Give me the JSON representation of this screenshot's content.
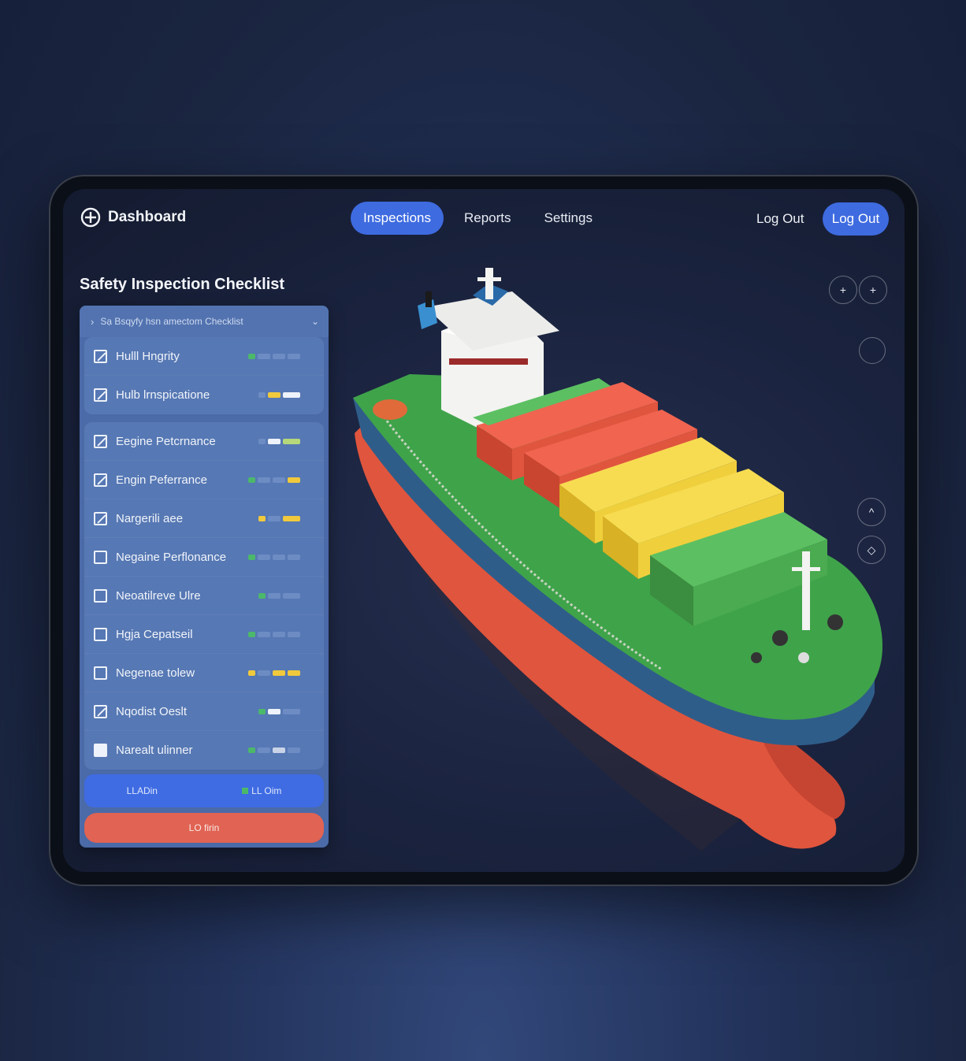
{
  "nav": {
    "brand": "Dashboard",
    "items": [
      {
        "label": "Inspections",
        "active": true
      },
      {
        "label": "Reports",
        "active": false
      },
      {
        "label": "Settings",
        "active": false
      }
    ],
    "logout_text": "Log Out",
    "logout_button": "Log Out"
  },
  "checklist": {
    "title": "Safety Inspection Checklist",
    "header": "Sạ Bsqyfy hsn amectom Checklist",
    "group1": [
      {
        "label": "Hulll Hngrity",
        "state": "checked",
        "bars": [
          "#4cb86a",
          "#6d8cc4",
          "#6d8cc4",
          "#6d8cc4"
        ]
      },
      {
        "label": "Hulb lrnspicatione",
        "state": "checked",
        "bars": [
          "#6d8cc4",
          "#f1c93c",
          "#eef2fa"
        ]
      }
    ],
    "group2": [
      {
        "label": "Eegine Petcrnance",
        "state": "checked",
        "bars": [
          "#6d8cc4",
          "#eef2fa",
          "#b6d87a"
        ]
      },
      {
        "label": "Engin Peferrance",
        "state": "checked",
        "bars": [
          "#4cb86a",
          "#6d8cc4",
          "#6d8cc4",
          "#f1c93c"
        ]
      },
      {
        "label": "Nargerili aee",
        "state": "checked",
        "bars": [
          "#f1c93c",
          "#6d8cc4",
          "#f1c93c"
        ]
      },
      {
        "label": "Negaine Perflonance",
        "state": "unchecked",
        "bars": [
          "#4cb86a",
          "#6d8cc4",
          "#6d8cc4",
          "#6d8cc4"
        ]
      },
      {
        "label": "Neoatilreve Ulre",
        "state": "unchecked",
        "bars": [
          "#4cb86a",
          "#6d8cc4",
          "#6d8cc4"
        ]
      },
      {
        "label": "Hgja Cepatseil",
        "state": "unchecked",
        "bars": [
          "#4cb86a",
          "#6d8cc4",
          "#6d8cc4",
          "#6d8cc4"
        ]
      },
      {
        "label": "Negenae tolew",
        "state": "unchecked",
        "bars": [
          "#f1c93c",
          "#6d8cc4",
          "#f1c93c",
          "#f1c93c"
        ]
      },
      {
        "label": "Nqodist Oeslt",
        "state": "checked",
        "bars": [
          "#4cb86a",
          "#eef2fa",
          "#6d8cc4"
        ]
      },
      {
        "label": "Narealt ulinner",
        "state": "filled",
        "bars": [
          "#4cb86a",
          "#6d8cc4",
          "#c9d3e8",
          "#6d8cc4"
        ]
      }
    ],
    "blue_left": "LLADin",
    "blue_right": "LL Oim",
    "red_button": "LO firin"
  },
  "controls": {
    "zoom_in_1": "+",
    "zoom_in_2": "+",
    "up": "^",
    "rotate": "◇"
  },
  "colors": {
    "accent": "#3e6be0",
    "panel": "#4a6aa8",
    "danger": "#e06353",
    "container_red": "#e2573f",
    "container_yellow": "#f0cf3c",
    "container_green": "#4aab50"
  }
}
